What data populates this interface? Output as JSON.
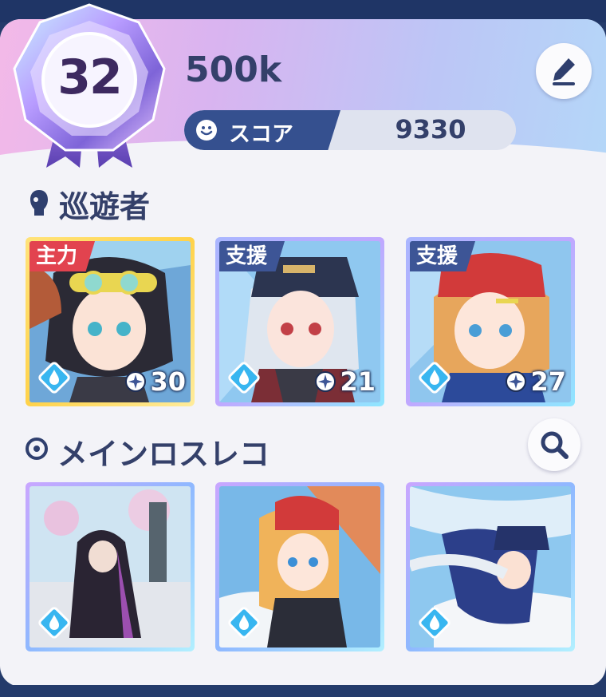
{
  "profile": {
    "level": "32",
    "name": "500k",
    "score_label": "スコア",
    "score_value": "9330"
  },
  "sections": {
    "travelers_title": "巡遊者",
    "memory_title": "メインロスレコ"
  },
  "travelers": [
    {
      "role": "主力",
      "level": "30",
      "element": "water-drop-icon",
      "frame": "gold"
    },
    {
      "role": "支援",
      "level": "21",
      "element": "water-drop-icon",
      "frame": "blue"
    },
    {
      "role": "支援",
      "level": "27",
      "element": "water-drop-icon",
      "frame": "blue"
    }
  ],
  "memories": [
    {
      "element": "water-drop-icon",
      "frame": "purple"
    },
    {
      "element": "water-drop-icon",
      "frame": "purple"
    },
    {
      "element": "water-drop-icon",
      "frame": "purple"
    }
  ],
  "colors": {
    "main_tag": "#e2434f",
    "support_tag": "#3d5596",
    "text_dark": "#34406a",
    "element_water": "#38b6f0"
  }
}
